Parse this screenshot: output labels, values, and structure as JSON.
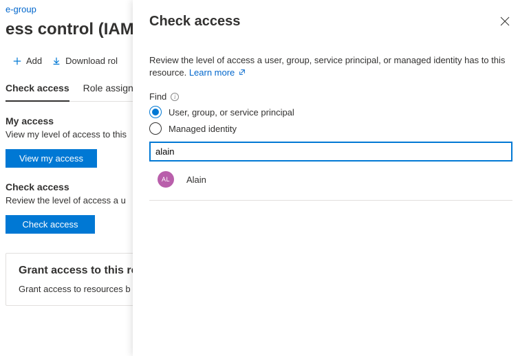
{
  "breadcrumb": {
    "label": "e-group"
  },
  "page_title": "ess control (IAM)",
  "toolbar": {
    "add": "Add",
    "download": "Download rol"
  },
  "tabs": {
    "check_access": "Check access",
    "role_assign": "Role assign"
  },
  "my_access": {
    "header": "My access",
    "desc": "View my level of access to this",
    "button": "View my access"
  },
  "check_access_section": {
    "header": "Check access",
    "desc": "Review the level of access a u",
    "button": "Check access"
  },
  "grant_card": {
    "title": "Grant access to this re",
    "desc": "Grant access to resources b"
  },
  "flyout": {
    "title": "Check access",
    "description": "Review the level of access a user, group, service principal, or managed identity has to this resource. ",
    "learn_more": "Learn more",
    "find_label": "Find",
    "radio_user": "User, group, or service principal",
    "radio_managed": "Managed identity",
    "search_value": "alain",
    "results": [
      {
        "initials": "AL",
        "name": "Alain"
      }
    ]
  }
}
